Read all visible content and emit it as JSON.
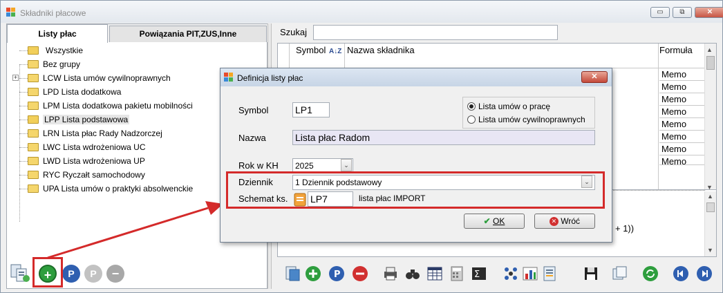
{
  "window": {
    "title": "Składniki płacowe",
    "min_label": "▭",
    "max_label": "⧉",
    "close_label": "✕"
  },
  "left": {
    "tabs": [
      {
        "label": "Listy płac"
      },
      {
        "label": "Powiązania PIT,ZUS,Inne"
      }
    ],
    "tree": [
      {
        "label": "Wszystkie"
      },
      {
        "label": "Bez grupy"
      },
      {
        "label": "LCW Lista umów cywilnoprawnych",
        "expander": "+"
      },
      {
        "label": "LPD Lista dodatkowa"
      },
      {
        "label": "LPM Lista dodatkowa pakietu mobilności"
      },
      {
        "label": "LPP Lista podstawowa"
      },
      {
        "label": "LRN Lista płac Rady Nadzorczej"
      },
      {
        "label": "LWC Lista wdrożeniowa UC"
      },
      {
        "label": "LWD Lista wdrożeniowa UP"
      },
      {
        "label": "RYC Ryczałt samochodowy"
      },
      {
        "label": "UPA Lista umów o praktyki absolwenckie"
      }
    ],
    "toolbar": {
      "add_symbol": "+",
      "p_symbol": "P",
      "minus_symbol": "−"
    }
  },
  "right": {
    "search_label": "Szukaj",
    "search_value": "",
    "columns": {
      "symbol": "Symbol",
      "sort_icon": "A↓Z",
      "name": "Nazwa składnika",
      "formula": "Formuła"
    },
    "formula_values": [
      "Memo",
      "Memo",
      "Memo",
      "Memo",
      "Memo",
      "Memo",
      "Memo",
      "Memo"
    ],
    "lower_formula_fragment": "+ 1))"
  },
  "dialog": {
    "title": "Definicja listy płac",
    "close_label": "✕",
    "symbol_label": "Symbol",
    "symbol_value": "LP1",
    "name_label": "Nazwa",
    "name_value": "Lista płac Radom",
    "radio_options": [
      {
        "label": "Lista umów o pracę",
        "checked": true
      },
      {
        "label": "Lista umów cywilnoprawnych",
        "checked": false
      }
    ],
    "year_label": "Rok w KH",
    "year_value": "2025",
    "journal_label": "Dziennik",
    "journal_value": "1  Dziennik podstawowy",
    "scheme_label": "Schemat ks.",
    "scheme_value": "LP7",
    "scheme_desc": "lista płac IMPORT",
    "ok_label": "OK",
    "cancel_label": "Wróć"
  },
  "colors": {
    "highlight": "#d42a2a",
    "add_green": "#2e9e3e",
    "delete_red": "#d13030",
    "p_blue": "#2f5fb0"
  }
}
